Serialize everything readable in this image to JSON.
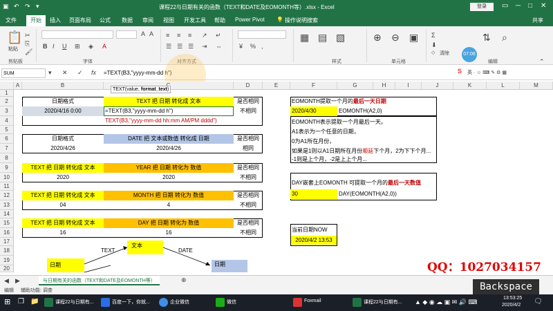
{
  "titlebar": {
    "title": "课程22与日期有关的函数（TEXT和DATE及EOMONTH等）.xlsx - Excel",
    "login": "登录"
  },
  "tabs": [
    "文件",
    "开始",
    "插入",
    "页面布局",
    "公式",
    "数据",
    "审阅",
    "视图",
    "开发工具",
    "帮助",
    "Power Pivot",
    "操作说明搜索",
    "共享"
  ],
  "ribbon": {
    "groups": [
      "剪贴板",
      "字体",
      "对齐方式",
      "样式",
      "单元格",
      "编辑"
    ],
    "paste": "粘贴",
    "clear": "清除",
    "time": "07:06"
  },
  "formula": {
    "namebox": "SUM",
    "formula": "=TEXT(B3,\"yyyy-mm-dd h\")",
    "tooltip_fn": "TEXT(value, ",
    "tooltip_arg": "format_text",
    ")": ")"
  },
  "columns": [
    "A",
    "B",
    "C",
    "D",
    "E",
    "F",
    "G",
    "H",
    "I",
    "J",
    "K",
    "L",
    "M"
  ],
  "rows": [
    "1",
    "2",
    "3",
    "4",
    "5",
    "6",
    "7",
    "8",
    "9",
    "10",
    "11",
    "12",
    "13",
    "14",
    "15",
    "16",
    "17",
    "18",
    "19",
    "20",
    "21"
  ],
  "cells": {
    "b2": "日期格式",
    "c2": "TEXT 把 日期 转化成 文本",
    "d2": "是否相同",
    "b3": "2020/4/16 0:00",
    "c3": "=TEXT(B3,\"yyyy-mm-dd h\")",
    "d3": "不相同",
    "c4": "TEXT(B3,\"yyyy-mm-dd hh:mm AM/PM dddd\")",
    "b6": "日期格式",
    "c6": "DATE 把 文本或数值 转化成 日期",
    "d6": "是否相同",
    "b7": "2020/4/26",
    "c7": "2020/4/26",
    "d7": "相同",
    "b9": "TEXT 把 日期 转化成 文本",
    "c9": "YEAR 把 日期 转化为 数值",
    "d9": "是否相同",
    "b10": "2020",
    "c10": "2020",
    "d10": "不相同",
    "b12": "TEXT 把 日期 转化成 文本",
    "c12": "MONTH 把 日期 转化为 数值",
    "d12": "是否相同",
    "b13": "04",
    "c13": "4",
    "d13": "不相同",
    "b15": "TEXT 把 日期 转化成 文本",
    "c15": "DAY 把 日期 转化为 数值",
    "d15": "是否相同",
    "b16": "16",
    "c16": "16",
    "d16": "不相同",
    "f2a": "EOMONTH提取一个月的",
    "f2b": "最后一天日期",
    "f3": "2020/4/30",
    "g3": "EOMONTH(A2,0)",
    "f5": "EOMONTH表示提取一个月最后一天。",
    "f6": "A1表示为一个任意的日期，",
    "f7": "0为A1所在月份，",
    "f8a": "如果是1则以A1日期所在月份",
    "f8b": "顺延",
    "f8c": "下个月，2为下下个月...",
    "f9": "-1则是上个月，-2是上上个月...",
    "f11a": "DAY嵌套上EOMONTH 可提取一个月的",
    "f11b": "最后一天数值",
    "f12": "30",
    "g12": "DAY(EOMONTH(A2,0))",
    "f15": "当前日期NOW",
    "f16": "2020/4/2 13:53"
  },
  "diagram": {
    "left": "日期",
    "mid": "文本",
    "right": "日期",
    "lab1": "TEXT",
    "lab2": "DATE"
  },
  "sheettab": "与日期有关的函数（TEXT和DATE及EOMONTH等）",
  "status": {
    "mode": "编辑",
    "accessibility": "辅助功能: 调查"
  },
  "overlay": {
    "qq": "QQ：1027034157",
    "key": "Backspace"
  },
  "taskbar": {
    "items": [
      "课程22与日期有...",
      "百度一下，你就...",
      "企业微信",
      "微信",
      "Foxmail",
      "课程22与日期有..."
    ],
    "time": "13:53:25",
    "date": "2020/4/2"
  },
  "colors": {
    "excel_green": "#217346",
    "yellow": "#ffff00",
    "orange": "#ffc000",
    "blue": "#b4c6e7",
    "red": "#c00000"
  }
}
